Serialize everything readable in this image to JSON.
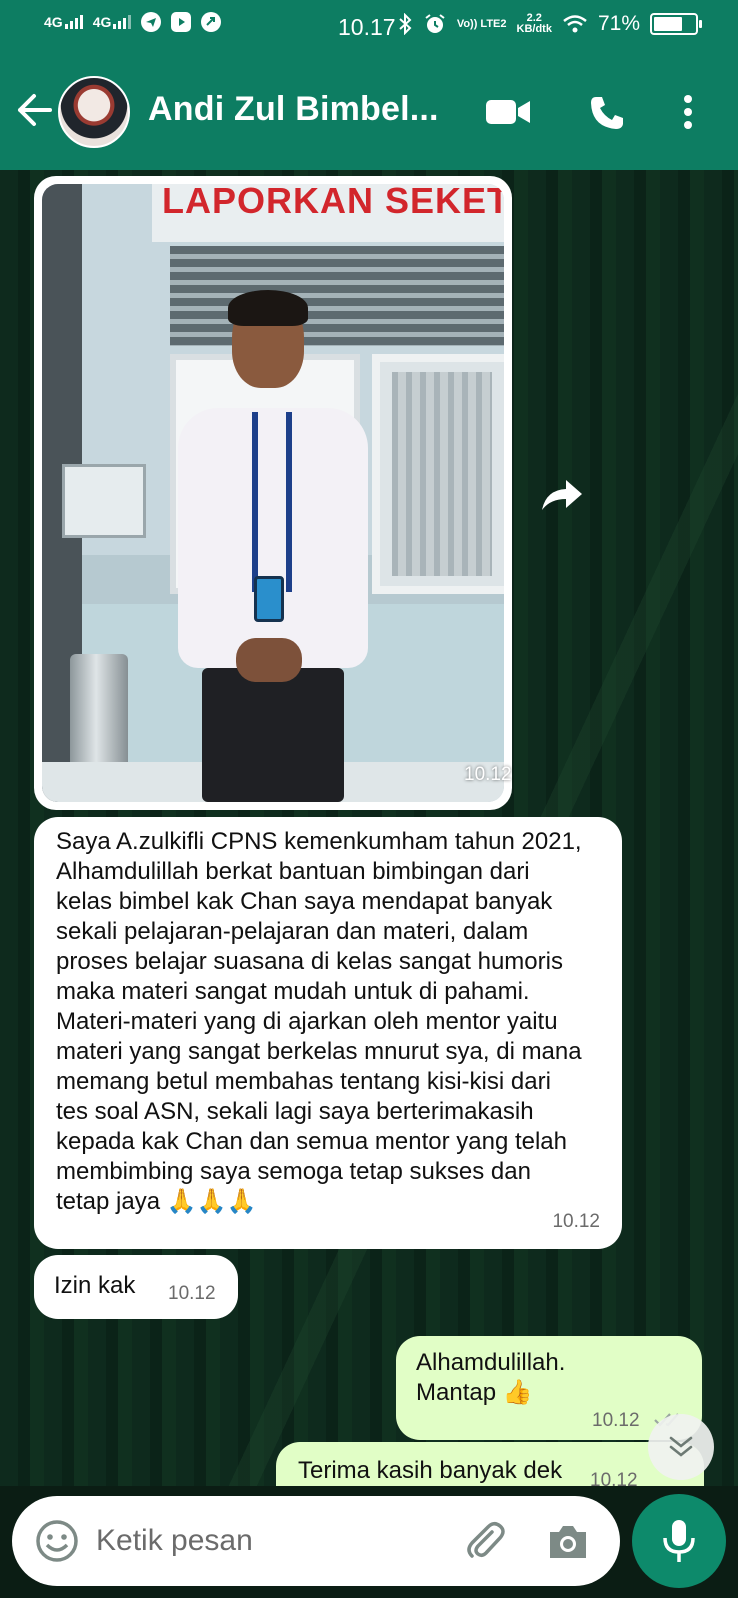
{
  "status_bar": {
    "network_1": "4G",
    "network_2": "4G",
    "time": "10.17",
    "volte": "Vo)) LTE2",
    "speed_value": "2.2",
    "speed_unit": "KB/dtk",
    "battery_percent": "71%",
    "battery_level": 0.71
  },
  "header": {
    "contact_name": "Andi Zul Bimbel...",
    "icons": [
      "back-arrow-icon",
      "video-call-icon",
      "phone-call-icon",
      "more-options-icon"
    ]
  },
  "messages": [
    {
      "type": "image",
      "direction": "incoming",
      "photo_banner_text": "LAPORKAN SEKETIK",
      "time": "10.12"
    },
    {
      "type": "text",
      "direction": "incoming",
      "text": "Saya A.zulkifli CPNS kemenkumham tahun 2021,\nAlhamdulillah berkat bantuan bimbingan dari\nkelas bimbel kak Chan saya mendapat banyak\nsekali pelajaran-pelajaran dan materi, dalam\nproses belajar suasana di kelas sangat humoris\nmaka materi sangat mudah untuk di pahami.\nMateri-materi yang di ajarkan oleh mentor yaitu\nmateri yang sangat berkelas mnurut sya, di mana\nmemang betul membahas tentang kisi-kisi dari\ntes soal ASN, sekali lagi saya berterimakasih\nkepada kak Chan dan semua mentor yang telah\nmembimbing saya semoga tetap sukses dan\ntetap jaya 🙏🙏🙏",
      "time": "10.12"
    },
    {
      "type": "text",
      "direction": "incoming",
      "text": "Izin kak",
      "time": "10.12"
    },
    {
      "type": "text",
      "direction": "outgoing",
      "text": "Alhamdulillah.\nMantap 👍",
      "time": "10.12"
    },
    {
      "type": "text",
      "direction": "outgoing",
      "text": "Terima kasih banyak dek",
      "time": "10.12"
    }
  ],
  "composer": {
    "placeholder": "Ketik pesan",
    "icons": [
      "emoji-icon",
      "attach-icon",
      "camera-icon",
      "mic-icon"
    ]
  },
  "colors": {
    "header_green": "#0d7d62",
    "outgoing_bubble": "#e1fec6",
    "incoming_bubble": "#ffffff",
    "mic_button": "#0d8a6b"
  }
}
